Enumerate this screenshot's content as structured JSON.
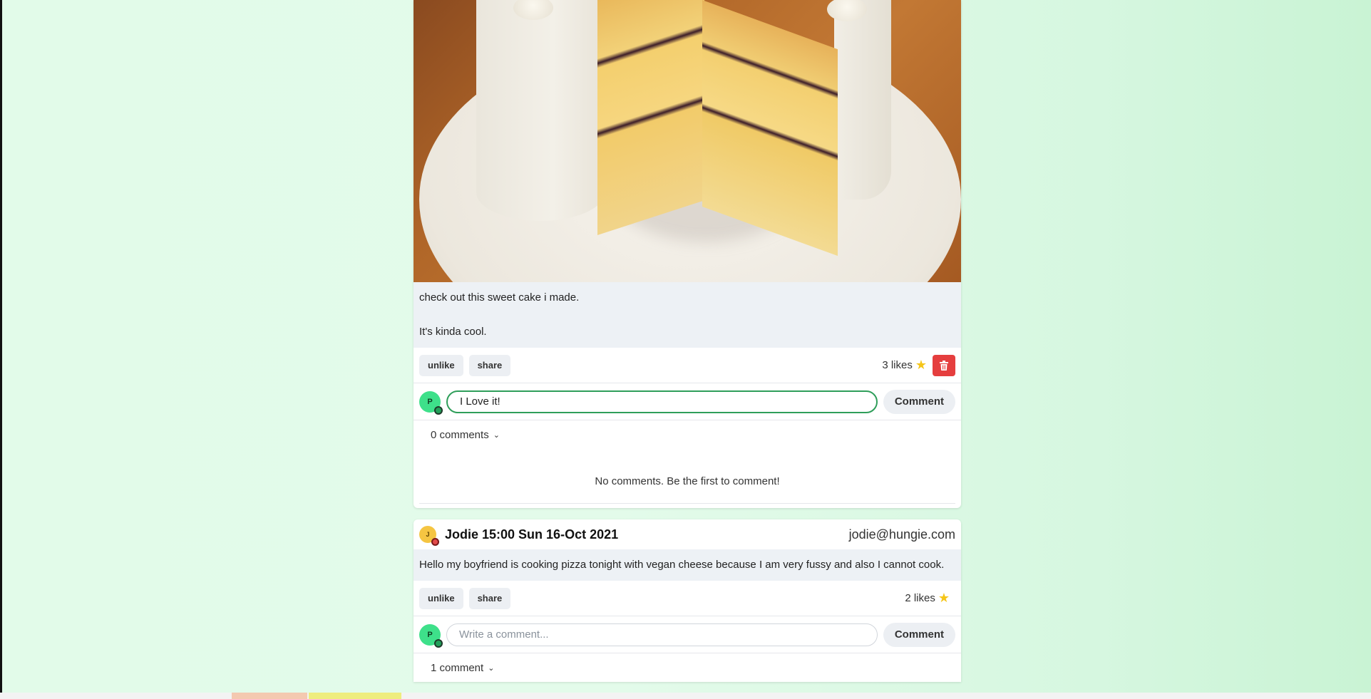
{
  "posts": [
    {
      "text_lines": [
        "check out this sweet cake i made.",
        "It's kinda cool."
      ],
      "actions": {
        "unlike_label": "unlike",
        "share_label": "share"
      },
      "likes_label": "3 likes",
      "composer": {
        "avatar_initial": "P",
        "input_value": "I Love it!",
        "placeholder": "Write a comment...",
        "button_label": "Comment"
      },
      "comments_count_label": "0 comments",
      "empty_message": "No comments. Be the first to comment!"
    },
    {
      "avatar_initial": "J",
      "author_line": "Jodie 15:00 Sun 16-Oct 2021",
      "email": "jodie@hungie.com",
      "text": "Hello my boyfriend is cooking pizza tonight with vegan cheese because I am very fussy and also I cannot cook.",
      "actions": {
        "unlike_label": "unlike",
        "share_label": "share"
      },
      "likes_label": "2 likes",
      "composer": {
        "avatar_initial": "P",
        "input_value": "",
        "placeholder": "Write a comment...",
        "button_label": "Comment"
      },
      "comments_count_label": "1 comment"
    }
  ],
  "icons": {
    "like": "star-icon",
    "delete": "trash-icon",
    "expand": "chevron-down-icon"
  },
  "colors": {
    "accent_green": "#2f9e5a",
    "delete_red": "#e53e3e",
    "star": "#f5c518"
  }
}
